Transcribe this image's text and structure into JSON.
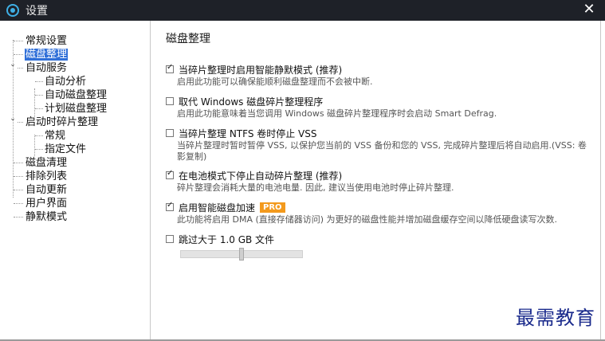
{
  "window": {
    "title": "设置",
    "close_glyph": "✕"
  },
  "sidebar": {
    "items": [
      {
        "label": "常规设置",
        "level": 0,
        "selected": false
      },
      {
        "label": "磁盘整理",
        "level": 0,
        "selected": true
      },
      {
        "label": "自动服务",
        "level": 0,
        "expanded": true
      },
      {
        "label": "自动分析",
        "level": 1
      },
      {
        "label": "自动磁盘整理",
        "level": 1
      },
      {
        "label": "计划磁盘整理",
        "level": 1
      },
      {
        "label": "启动时碎片整理",
        "level": 0,
        "expanded": true
      },
      {
        "label": "常规",
        "level": 1
      },
      {
        "label": "指定文件",
        "level": 1
      },
      {
        "label": "磁盘清理",
        "level": 0
      },
      {
        "label": "排除列表",
        "level": 0
      },
      {
        "label": "自动更新",
        "level": 0
      },
      {
        "label": "用户界面",
        "level": 0
      },
      {
        "label": "静默模式",
        "level": 0
      }
    ],
    "expand_glyph": "⌄"
  },
  "main": {
    "title": "磁盘整理",
    "options": [
      {
        "label": "当碎片整理时启用智能静默模式 (推荐)",
        "checked": true,
        "desc": "启用此功能可以确保能顺利磁盘整理而不会被中断."
      },
      {
        "label": "取代 Windows 磁盘碎片整理程序",
        "checked": false,
        "desc": "启用此功能意味着当您调用 Windows 磁盘碎片整理程序时会启动 Smart Defrag."
      },
      {
        "label": "当碎片整理 NTFS 卷时停止 VSS",
        "checked": false,
        "desc": "当碎片整理时暂时暂停 VSS, 以保护您当前的 VSS 备份和您的 VSS, 完成碎片整理后将自动启用.(VSS: 卷影复制)"
      },
      {
        "label": "在电池模式下停止自动碎片整理 (推荐)",
        "checked": true,
        "desc": "碎片整理会消耗大量的电池电量. 因此, 建议当使用电池时停止碎片整理."
      },
      {
        "label": "启用智能磁盘加速",
        "checked": true,
        "badge": "PRO",
        "desc": "此功能将启用 DMA (直接存储器访问) 为更好的磁盘性能并增加磁盘缓存空间以降低硬盘读写次数."
      },
      {
        "label": "跳过大于 1.0 GB 文件",
        "checked": false,
        "desc": ""
      }
    ],
    "size_slider": {
      "value_fraction": 0.5
    }
  },
  "watermark": {
    "text": "最需教育"
  },
  "colors": {
    "titlebar": "#1e2128",
    "selection": "#2f6fd8",
    "pro_badge": "#f39a1d",
    "watermark": "#1a2a8c"
  }
}
